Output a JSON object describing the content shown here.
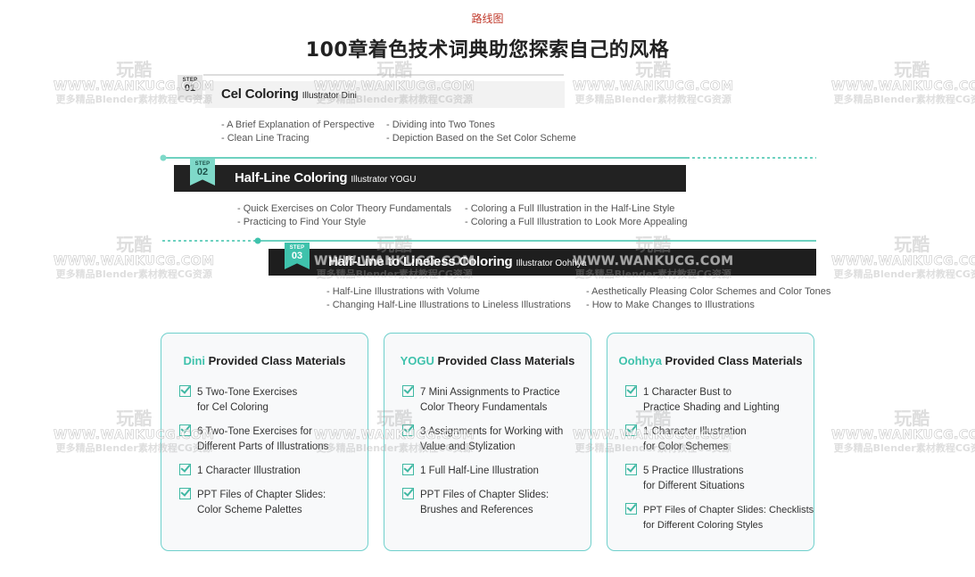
{
  "header": {
    "kicker": "路线图",
    "title": "100章着色技术词典助您探索自己的风格"
  },
  "steps": [
    {
      "step_label": "STEP",
      "number": "01",
      "title": "Cel Coloring",
      "illustrator": "Illustrator Dini",
      "left_points": [
        "- A Brief Explanation of Perspective",
        "- Clean Line Tracing"
      ],
      "right_points": [
        "- Dividing into Two Tones",
        "- Depiction Based on the Set Color Scheme"
      ]
    },
    {
      "step_label": "STEP",
      "number": "02",
      "title": "Half-Line Coloring",
      "illustrator": "Illustrator YOGU",
      "left_points": [
        "- Quick Exercises on Color Theory Fundamentals",
        "- Practicing to Find Your Style"
      ],
      "right_points": [
        "- Coloring a Full Illustration in the Half-Line Style",
        "- Coloring a Full Illustration to Look More Appealing"
      ]
    },
    {
      "step_label": "STEP",
      "number": "03",
      "title": "Half-Line to Lineless Coloring",
      "illustrator": "Illustrator Oohhya",
      "left_points": [
        "- Half-Line Illustrations with Volume",
        "- Changing Half-Line Illustrations to Lineless Illustrations"
      ],
      "right_points": [
        "- Aesthetically Pleasing Color Schemes and Color Tones",
        "- How to Make Changes to Illustrations"
      ]
    }
  ],
  "cards": [
    {
      "name": "Dini",
      "suffix": " Provided Class Materials",
      "items": [
        [
          "5 Two-Tone Exercises",
          "for Cel Coloring"
        ],
        [
          "6 Two-Tone Exercises for",
          "Different Parts of Illustrations"
        ],
        [
          "1 Character Illustration",
          ""
        ],
        [
          "PPT Files of Chapter Slides:",
          "Color Scheme Palettes"
        ]
      ]
    },
    {
      "name": "YOGU",
      "suffix": " Provided Class Materials",
      "items": [
        [
          "7 Mini Assignments to Practice",
          "Color Theory Fundamentals"
        ],
        [
          "3 Assignments for Working with",
          "Value and Stylization"
        ],
        [
          "1 Full Half-Line Illustration",
          ""
        ],
        [
          "PPT Files of Chapter Slides:",
          "Brushes and References"
        ]
      ]
    },
    {
      "name": "Oohhya",
      "suffix": " Provided Class Materials",
      "items": [
        [
          "1 Character Bust to",
          "Practice Shading and Lighting"
        ],
        [
          "1 Character Illustration",
          "for Color Schemes"
        ],
        [
          "5 Practice Illustrations",
          "for Different Situations"
        ],
        [
          "PPT Files of Chapter Slides: Checklists",
          "for Different Coloring Styles"
        ]
      ]
    }
  ],
  "watermark": {
    "logo": "玩酷",
    "site": "WWW.WANKUCG.COM",
    "tagline": "更多精品Blender素材教程CG资源"
  },
  "colors": {
    "accent": "#3fc2ac",
    "dark_bar": "#222222",
    "light_bar": "#f2f2f2",
    "kicker": "#c0392b"
  }
}
